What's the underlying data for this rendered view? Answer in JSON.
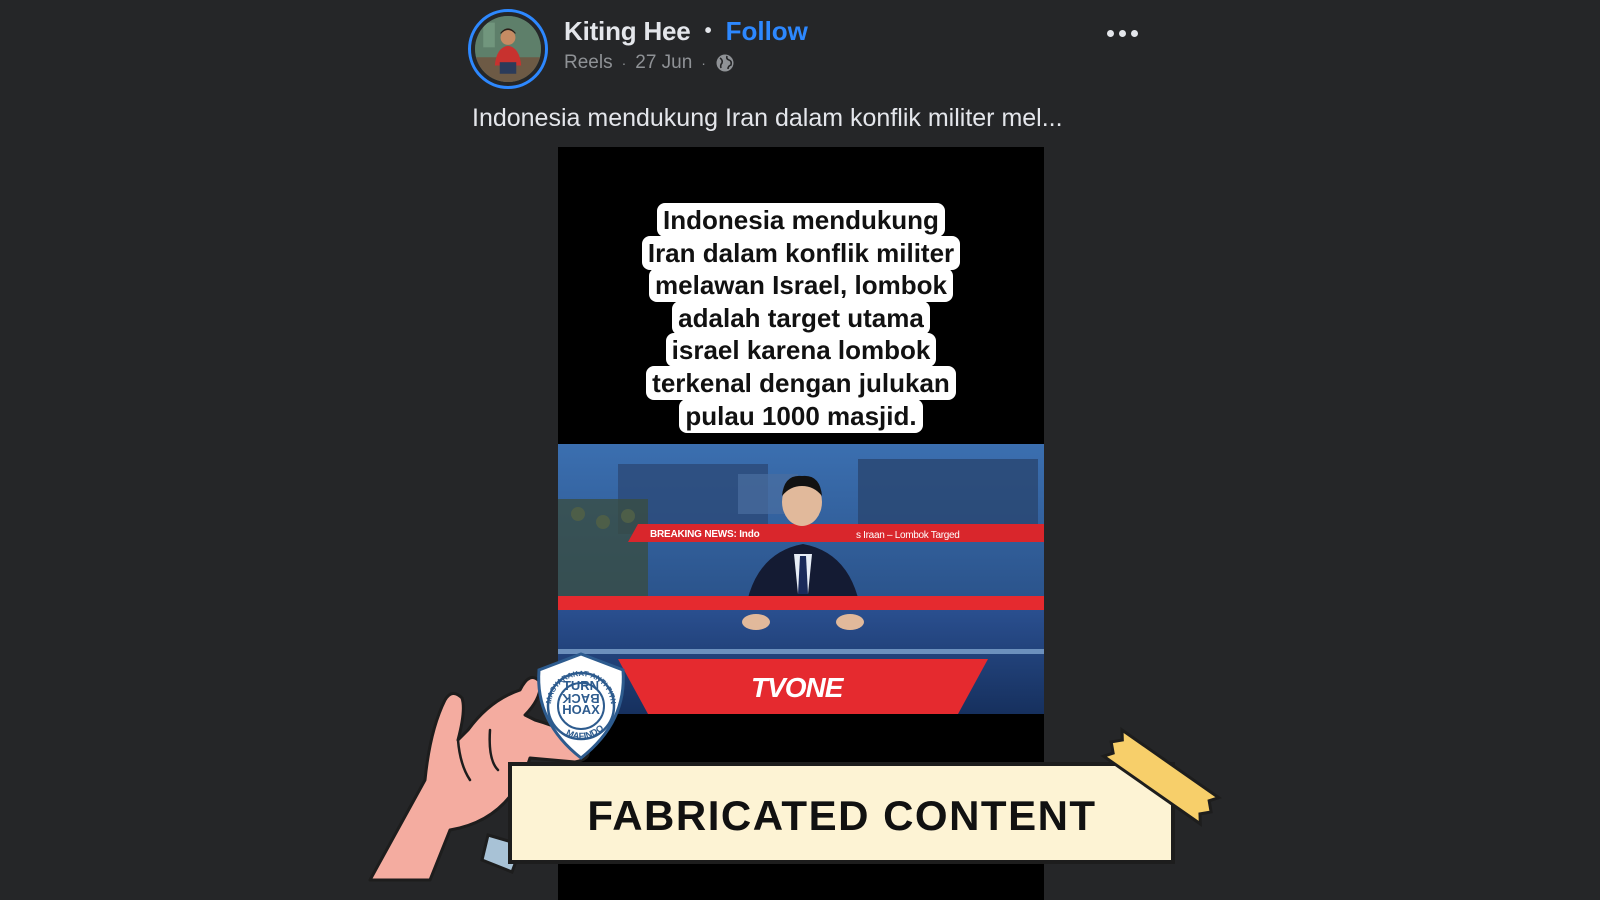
{
  "post": {
    "author": "Kiting Hee",
    "separator": "•",
    "follow_label": "Follow",
    "meta": {
      "source": "Reels",
      "dot": "·",
      "date": "27 Jun",
      "privacy_icon": "globe-icon"
    },
    "more_icon": "more-options-icon",
    "caption": "Indonesia mendukung Iran dalam konflik militer mel..."
  },
  "video": {
    "overlay_caption_lines": [
      "Indonesia mendukung",
      "Iran dalam konflik militer",
      "melawan Israel, lombok",
      "adalah target utama",
      "israel karena lombok",
      "terkenal dengan julukan",
      "pulau 1000 masjid."
    ],
    "ticker_label": "BREAKING NEWS: Indo",
    "ticker_tail": "s Iraan – Lombok Targed",
    "channel": "TVONE"
  },
  "stamp": {
    "badge_ring_text": "MASYARAKAT ANTI FITNAH INDONESIA",
    "badge_bottom": "MAFINDO",
    "badge_center": [
      "TURN",
      "BACK",
      "HOAX"
    ],
    "label": "FABRICATED CONTENT"
  },
  "colors": {
    "background": "#252628",
    "accent": "#2d88ff",
    "banner_fill": "#fdf3d4",
    "tape": "#f7cf6a",
    "hand": "#f4aca0"
  }
}
